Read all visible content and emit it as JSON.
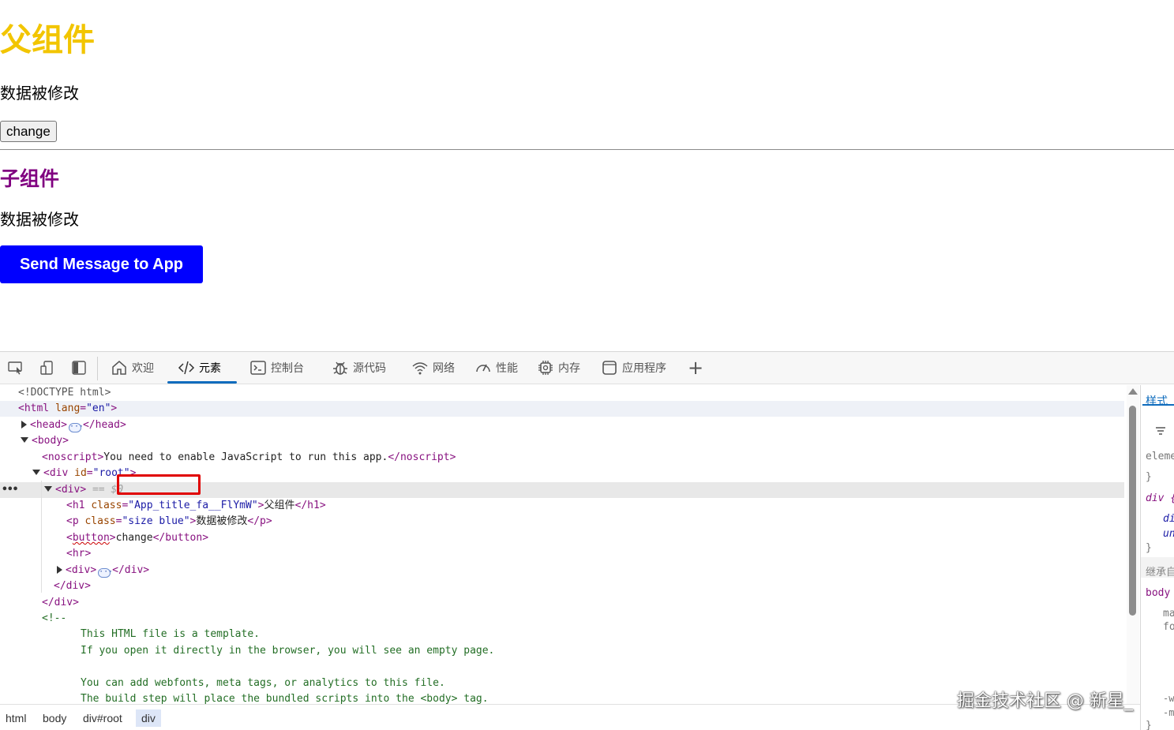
{
  "page": {
    "parent_title": "父组件",
    "parent_message": "数据被修改",
    "change_button": "change",
    "child_title": "子组件",
    "child_message": "数据被修改",
    "send_button": "Send Message to App"
  },
  "devtools": {
    "tabs": [
      {
        "label": "欢迎",
        "icon": "home-icon"
      },
      {
        "label": "元素",
        "icon": "code-icon",
        "active": true
      },
      {
        "label": "控制台",
        "icon": "console-icon"
      },
      {
        "label": "源代码",
        "icon": "bug-icon"
      },
      {
        "label": "网络",
        "icon": "wifi-icon"
      },
      {
        "label": "性能",
        "icon": "gauge-icon"
      },
      {
        "label": "内存",
        "icon": "chip-icon"
      },
      {
        "label": "应用程序",
        "icon": "app-window-icon"
      }
    ],
    "dom": {
      "doctype": "<!DOCTYPE html>",
      "html_open": "html",
      "lang_attr": "lang",
      "lang_val": "\"en\"",
      "head": "head",
      "body": "body",
      "noscript": "noscript",
      "noscript_text": "You need to enable JavaScript to run this app.",
      "div": "div",
      "id_attr": "id",
      "root_val": "\"root\"",
      "selected_marker": "== $0",
      "h1": "h1",
      "class_attr": "class",
      "h1_class_val": "\"App_title_fa__FlYmW\"",
      "h1_text": "父组件",
      "p": "p",
      "p_class_val": "\"size blue\"",
      "p_text": "数据被修改",
      "button": "button",
      "button_text": "change",
      "hr": "hr",
      "comment_open": "<!--",
      "comment_lines": [
        "This HTML file is a template.",
        "If you open it directly in the browser, you will see an empty page.",
        "",
        "You can add webfonts, meta tags, or analytics to this file.",
        "The build step will place the bundled scripts into the <body> tag."
      ]
    },
    "styles_panel": {
      "tab": "样式",
      "lines": [
        "eleme",
        "}",
        "div {",
        "di",
        "un",
        "}",
        "继承自",
        "body",
        "ma",
        "fo",
        "-w",
        "-m",
        "}"
      ]
    },
    "breadcrumb": [
      "html",
      "body",
      "div#root",
      "div"
    ]
  },
  "watermark": "掘金技术社区 @ 新星_"
}
